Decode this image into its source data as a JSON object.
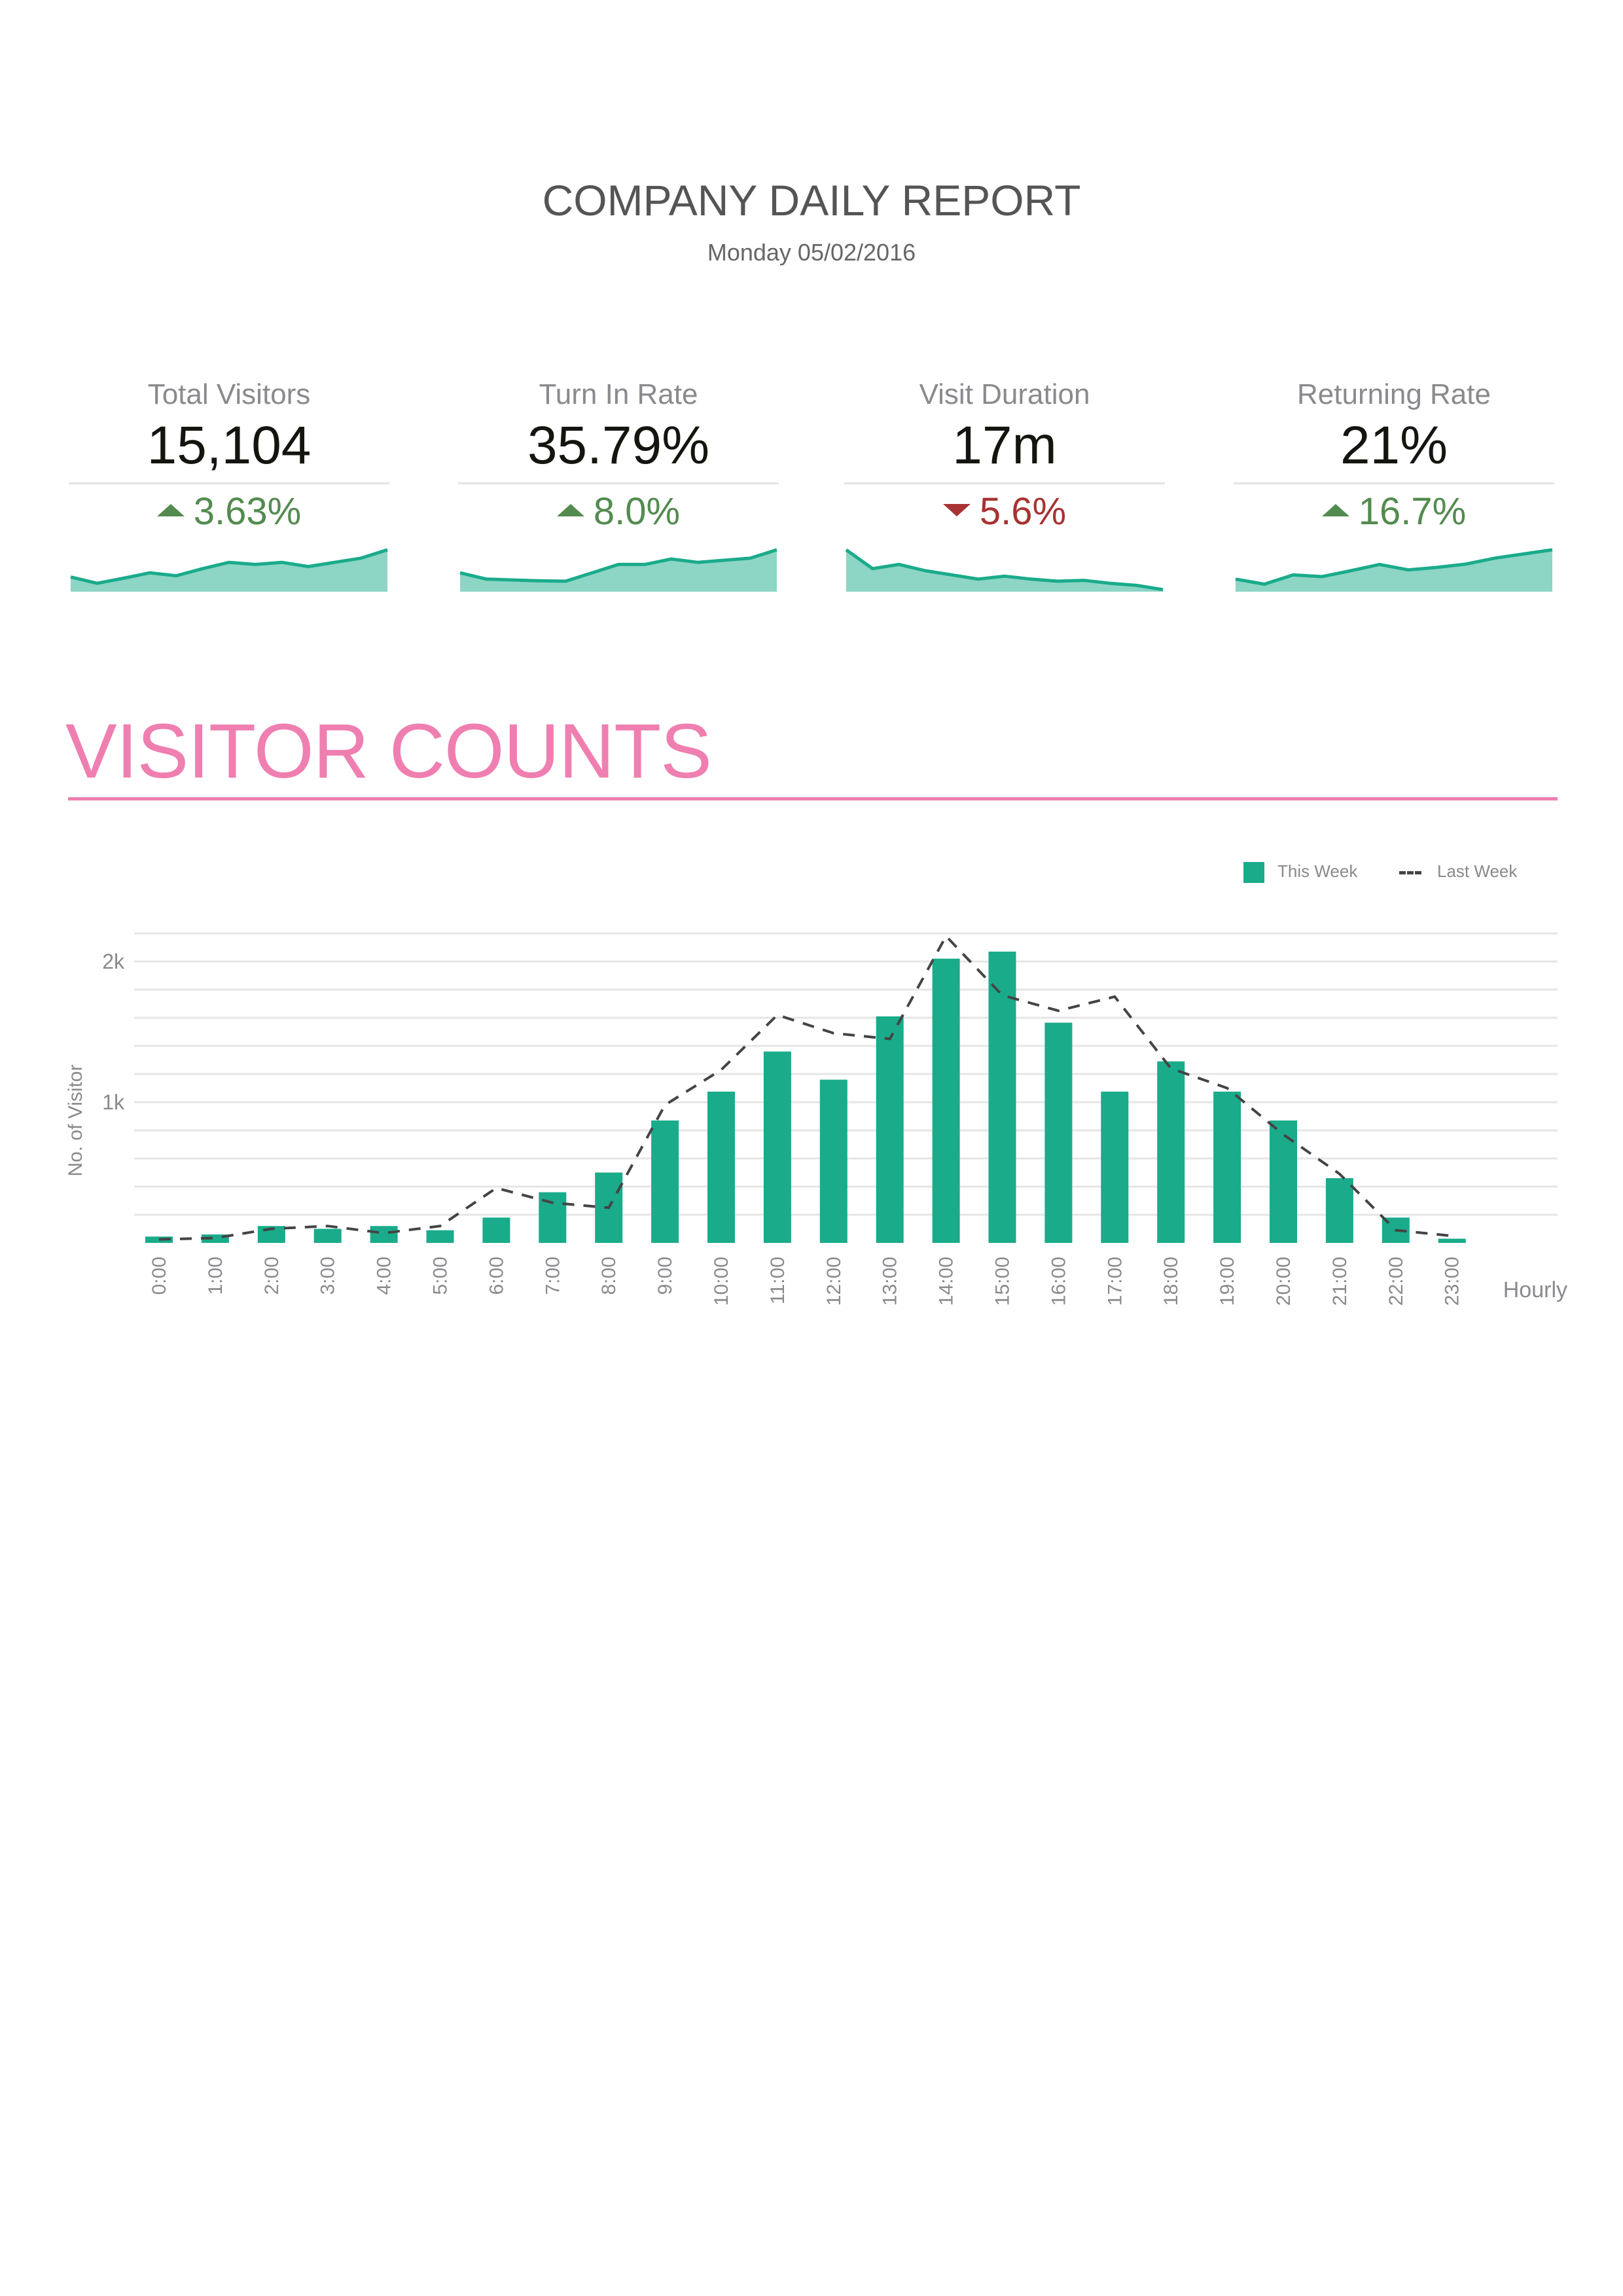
{
  "header": {
    "title": "COMPANY DAILY REPORT",
    "date": "Monday 05/02/2016"
  },
  "colors": {
    "accent": "#ef7fb0",
    "bar": "#1aab8b",
    "spark_line": "#1aab8b",
    "spark_fill": "#8dd5c5",
    "up": "#538b4f",
    "down": "#a83232",
    "last_week_line": "#444444"
  },
  "kpis": [
    {
      "label": "Total Visitors",
      "value": "15,104",
      "delta": "3.63%",
      "direction": "up",
      "trend": [
        0.35,
        0.2,
        0.32,
        0.45,
        0.38,
        0.55,
        0.7,
        0.65,
        0.7,
        0.6,
        0.7,
        0.8,
        1.0
      ]
    },
    {
      "label": "Turn In Rate",
      "value": "35.79%",
      "delta": "8.0%",
      "direction": "up",
      "trend": [
        0.45,
        0.3,
        0.28,
        0.26,
        0.25,
        0.45,
        0.65,
        0.65,
        0.78,
        0.7,
        0.75,
        0.8,
        1.0
      ]
    },
    {
      "label": "Visit Duration",
      "value": "17m",
      "delta": "5.6%",
      "direction": "down",
      "trend": [
        1.0,
        0.55,
        0.65,
        0.5,
        0.4,
        0.3,
        0.37,
        0.3,
        0.25,
        0.27,
        0.2,
        0.15,
        0.05
      ]
    },
    {
      "label": "Returning Rate",
      "value": "21%",
      "delta": "16.7%",
      "direction": "up",
      "trend": [
        0.3,
        0.18,
        0.4,
        0.36,
        0.5,
        0.65,
        0.52,
        0.58,
        0.66,
        0.8,
        0.9,
        1.0
      ]
    }
  ],
  "section": {
    "title": "VISITOR COUNTS"
  },
  "chart_data": {
    "type": "bar",
    "title": "VISITOR COUNTS",
    "xlabel": "Hourly",
    "ylabel": "No. of Visitor",
    "ylim": [
      0,
      2200
    ],
    "y_ticks": [
      {
        "value": 1000,
        "label": "1k"
      },
      {
        "value": 2000,
        "label": "2k"
      }
    ],
    "grid_step": 200,
    "grid": true,
    "legend_position": "top-right",
    "categories": [
      "0:00",
      "1:00",
      "2:00",
      "3:00",
      "4:00",
      "5:00",
      "6:00",
      "7:00",
      "8:00",
      "9:00",
      "10:00",
      "11:00",
      "12:00",
      "13:00",
      "14:00",
      "15:00",
      "16:00",
      "17:00",
      "18:00",
      "19:00",
      "20:00",
      "21:00",
      "22:00",
      "23:00"
    ],
    "series": [
      {
        "name": "This Week",
        "type": "bar",
        "values": [
          45,
          60,
          120,
          100,
          120,
          90,
          180,
          360,
          500,
          870,
          1075,
          1360,
          1160,
          1610,
          2020,
          2070,
          1565,
          1075,
          1290,
          1075,
          870,
          460,
          180,
          30
        ]
      },
      {
        "name": "Last Week",
        "type": "line",
        "style": "dashed",
        "values": [
          25,
          35,
          100,
          120,
          70,
          120,
          390,
          285,
          250,
          980,
          1230,
          1620,
          1490,
          1450,
          2180,
          1760,
          1650,
          1750,
          1240,
          1100,
          770,
          490,
          90,
          50
        ]
      }
    ]
  }
}
